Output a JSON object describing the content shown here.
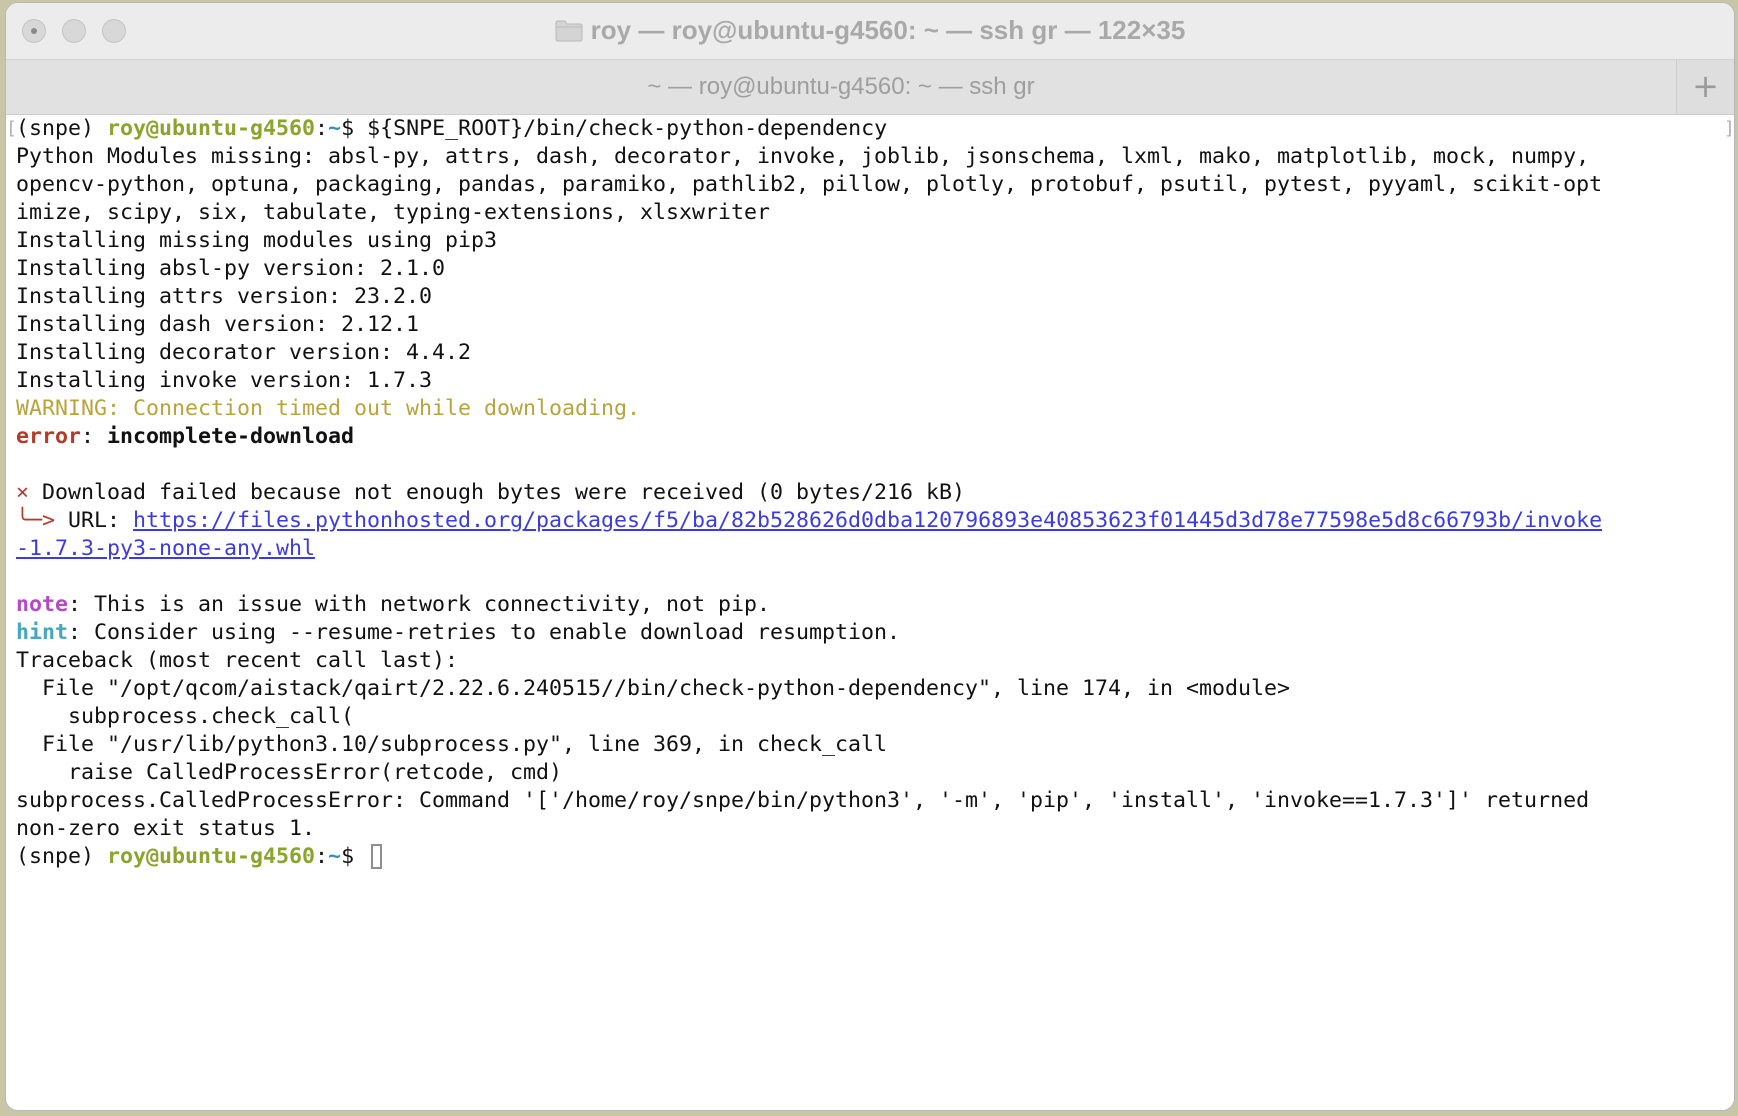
{
  "window": {
    "title": "roy — roy@ubuntu-g4560: ~ — ssh gr — 122×35",
    "tab_label": "~ — roy@ubuntu-g4560: ~ — ssh gr",
    "new_tab_label": "+"
  },
  "terminal": {
    "prompt_env": "(snpe) ",
    "prompt_user": "roy@ubuntu-g4560",
    "prompt_sep": ":",
    "prompt_dir": "~",
    "prompt_symbol": "$ ",
    "command": "${SNPE_ROOT}/bin/check-python-dependency",
    "missing_line_1": "Python Modules missing: absl-py, attrs, dash, decorator, invoke, joblib, jsonschema, lxml, mako, matplotlib, mock, numpy,",
    "missing_line_2": "opencv-python, optuna, packaging, pandas, paramiko, pathlib2, pillow, plotly, protobuf, psutil, pytest, pyyaml, scikit-opt",
    "missing_line_3": "imize, scipy, six, tabulate, typing-extensions, xlsxwriter",
    "installing_using": "Installing missing modules using pip3",
    "install_absl": "Installing absl-py version: 2.1.0",
    "install_attrs": "Installing attrs version: 23.2.0",
    "install_dash": "Installing dash version: 2.12.1",
    "install_decorator": "Installing decorator version: 4.4.2",
    "install_invoke": "Installing invoke version: 1.7.3",
    "warning": "WARNING: Connection timed out while downloading.",
    "error_label": "error",
    "error_sep": ": ",
    "error_message": "incomplete-download",
    "x_mark": "×",
    "download_failed": " Download failed because not enough bytes were received (0 bytes/216 kB)",
    "url_arrow": "╰─>",
    "url_label": " URL: ",
    "url_part_1": "https://files.pythonhosted.org/packages/f5/ba/82b528626d0dba120796893e40853623f01445d3d78e77598e5d8c66793b/invoke",
    "url_part_2": "-1.7.3-py3-none-any.whl",
    "note_label": "note",
    "note_text": ": This is an issue with network connectivity, not pip.",
    "hint_label": "hint",
    "hint_text": ": Consider using --resume-retries to enable download resumption.",
    "traceback_header": "Traceback (most recent call last):",
    "tb_file_1": "  File \"/opt/qcom/aistack/qairt/2.22.6.240515//bin/check-python-dependency\", line 174, in <module>",
    "tb_code_1": "    subprocess.check_call(",
    "tb_file_2": "  File \"/usr/lib/python3.10/subprocess.py\", line 369, in check_call",
    "tb_code_2": "    raise CalledProcessError(retcode, cmd)",
    "exception_line_1": "subprocess.CalledProcessError: Command '['/home/roy/snpe/bin/python3', '-m', 'pip', 'install', 'invoke==1.7.3']' returned",
    "exception_line_2": "non-zero exit status 1."
  },
  "colors": {
    "prompt_user": "#8aa52c",
    "prompt_dir": "#3d8fb8",
    "warning": "#b8a43a",
    "error": "#b23b2b",
    "link": "#3b3be3",
    "note": "#b54ac7",
    "hint": "#46a8bd"
  },
  "icons": {
    "window_icon": "folder-icon"
  }
}
